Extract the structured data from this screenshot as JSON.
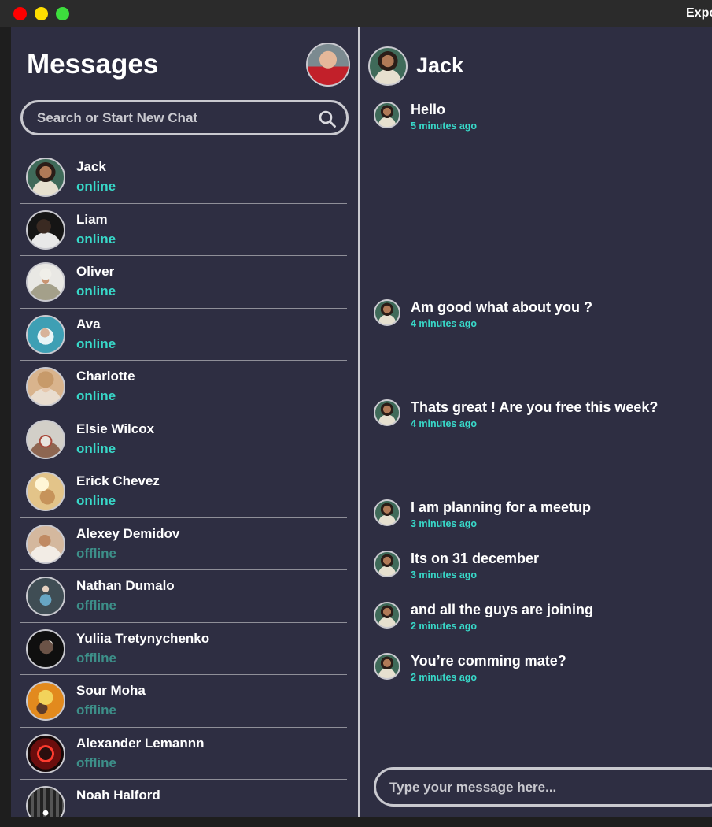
{
  "window": {
    "title": "Expo"
  },
  "sidebar": {
    "title": "Messages",
    "search_placeholder": "Search or Start New Chat",
    "contacts": [
      {
        "name": "Jack",
        "status": "online"
      },
      {
        "name": "Liam",
        "status": "online"
      },
      {
        "name": "Oliver",
        "status": "online"
      },
      {
        "name": "Ava",
        "status": "online"
      },
      {
        "name": "Charlotte",
        "status": "online"
      },
      {
        "name": "Elsie Wilcox",
        "status": "online"
      },
      {
        "name": "Erick Chevez",
        "status": "online"
      },
      {
        "name": "Alexey Demidov",
        "status": "offline"
      },
      {
        "name": "Nathan Dumalo",
        "status": "offline"
      },
      {
        "name": "Yuliia Tretynychenko",
        "status": "offline"
      },
      {
        "name": "Sour Moha",
        "status": "offline"
      },
      {
        "name": "Alexander Lemannn",
        "status": "offline"
      },
      {
        "name": "Noah Halford",
        "status": ""
      }
    ]
  },
  "chat": {
    "contact_name": "Jack",
    "messages": [
      {
        "text": "Hello",
        "time": "5 minutes ago"
      },
      {
        "text": "Am good what about you ?",
        "time": "4 minutes ago"
      },
      {
        "text": "Thats great ! Are you free this week?",
        "time": "4 minutes ago"
      },
      {
        "text": "I am planning for a meetup",
        "time": "3 minutes ago"
      },
      {
        "text": "Its on 31 december",
        "time": "3 minutes ago"
      },
      {
        "text": "and all the guys are joining",
        "time": "2 minutes ago"
      },
      {
        "text": "You’re comming mate?",
        "time": "2 minutes ago"
      }
    ],
    "compose_placeholder": "Type your message here..."
  },
  "colors": {
    "background": "#2e2e42",
    "accent_online": "#38d9c9",
    "accent_offline": "#3d8f89",
    "border": "#c9c9cf",
    "titlebar": "#2b2b2b"
  },
  "icons": {
    "search": "search-icon",
    "window_close": "close-dot-icon",
    "window_minimize": "minimize-dot-icon",
    "window_maximize": "maximize-dot-icon"
  }
}
